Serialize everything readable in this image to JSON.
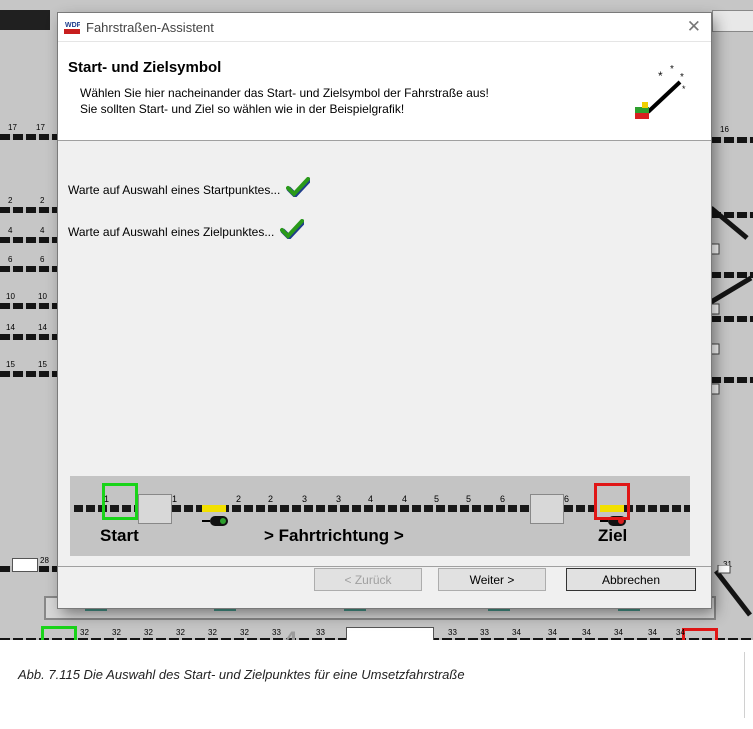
{
  "dialog": {
    "title": "Fahrstraßen-Assistent",
    "close_glyph": "✕",
    "header": {
      "title": "Start- und Zielsymbol",
      "line1": "Wählen Sie hier nacheinander das Start- und Zielsymbol der Fahrstraße aus!",
      "line2": "Sie sollten Start- und Ziel so wählen wie in der Beispielgrafik!"
    },
    "status": {
      "start": "Warte auf Auswahl eines Startpunktes...",
      "end": "Warte auf Auswahl eines Zielpunktes..."
    },
    "example": {
      "start_label": "Start",
      "direction_label": "> Fahrtrichtung >",
      "end_label": "Ziel",
      "track_numbers": [
        "1",
        "1",
        "2",
        "2",
        "3",
        "3",
        "4",
        "4",
        "5",
        "5",
        "6",
        "6"
      ]
    },
    "buttons": {
      "back": "< Zurück",
      "next": "Weiter >",
      "cancel": "Abbrechen"
    }
  },
  "background": {
    "left_labels": [
      "17",
      "17",
      "2",
      "2",
      "4",
      "4",
      "6",
      "6",
      "10",
      "10",
      "14",
      "14",
      "15",
      "15"
    ],
    "right_labels": [
      "16",
      "31"
    ],
    "bottom_labels": [
      "28",
      "32",
      "32",
      "32",
      "32",
      "32",
      "32",
      "33",
      "33",
      "33",
      "33",
      "34",
      "34",
      "34",
      "34",
      "34",
      "34"
    ],
    "big_number": "4"
  },
  "caption": "Abb. 7.115  Die Auswahl des Start- und Zielpunktes für eine Umsetzfahrstraße",
  "colors": {
    "start_frame": "#19d419",
    "end_frame": "#e01616",
    "check": "#2a9a1a"
  }
}
